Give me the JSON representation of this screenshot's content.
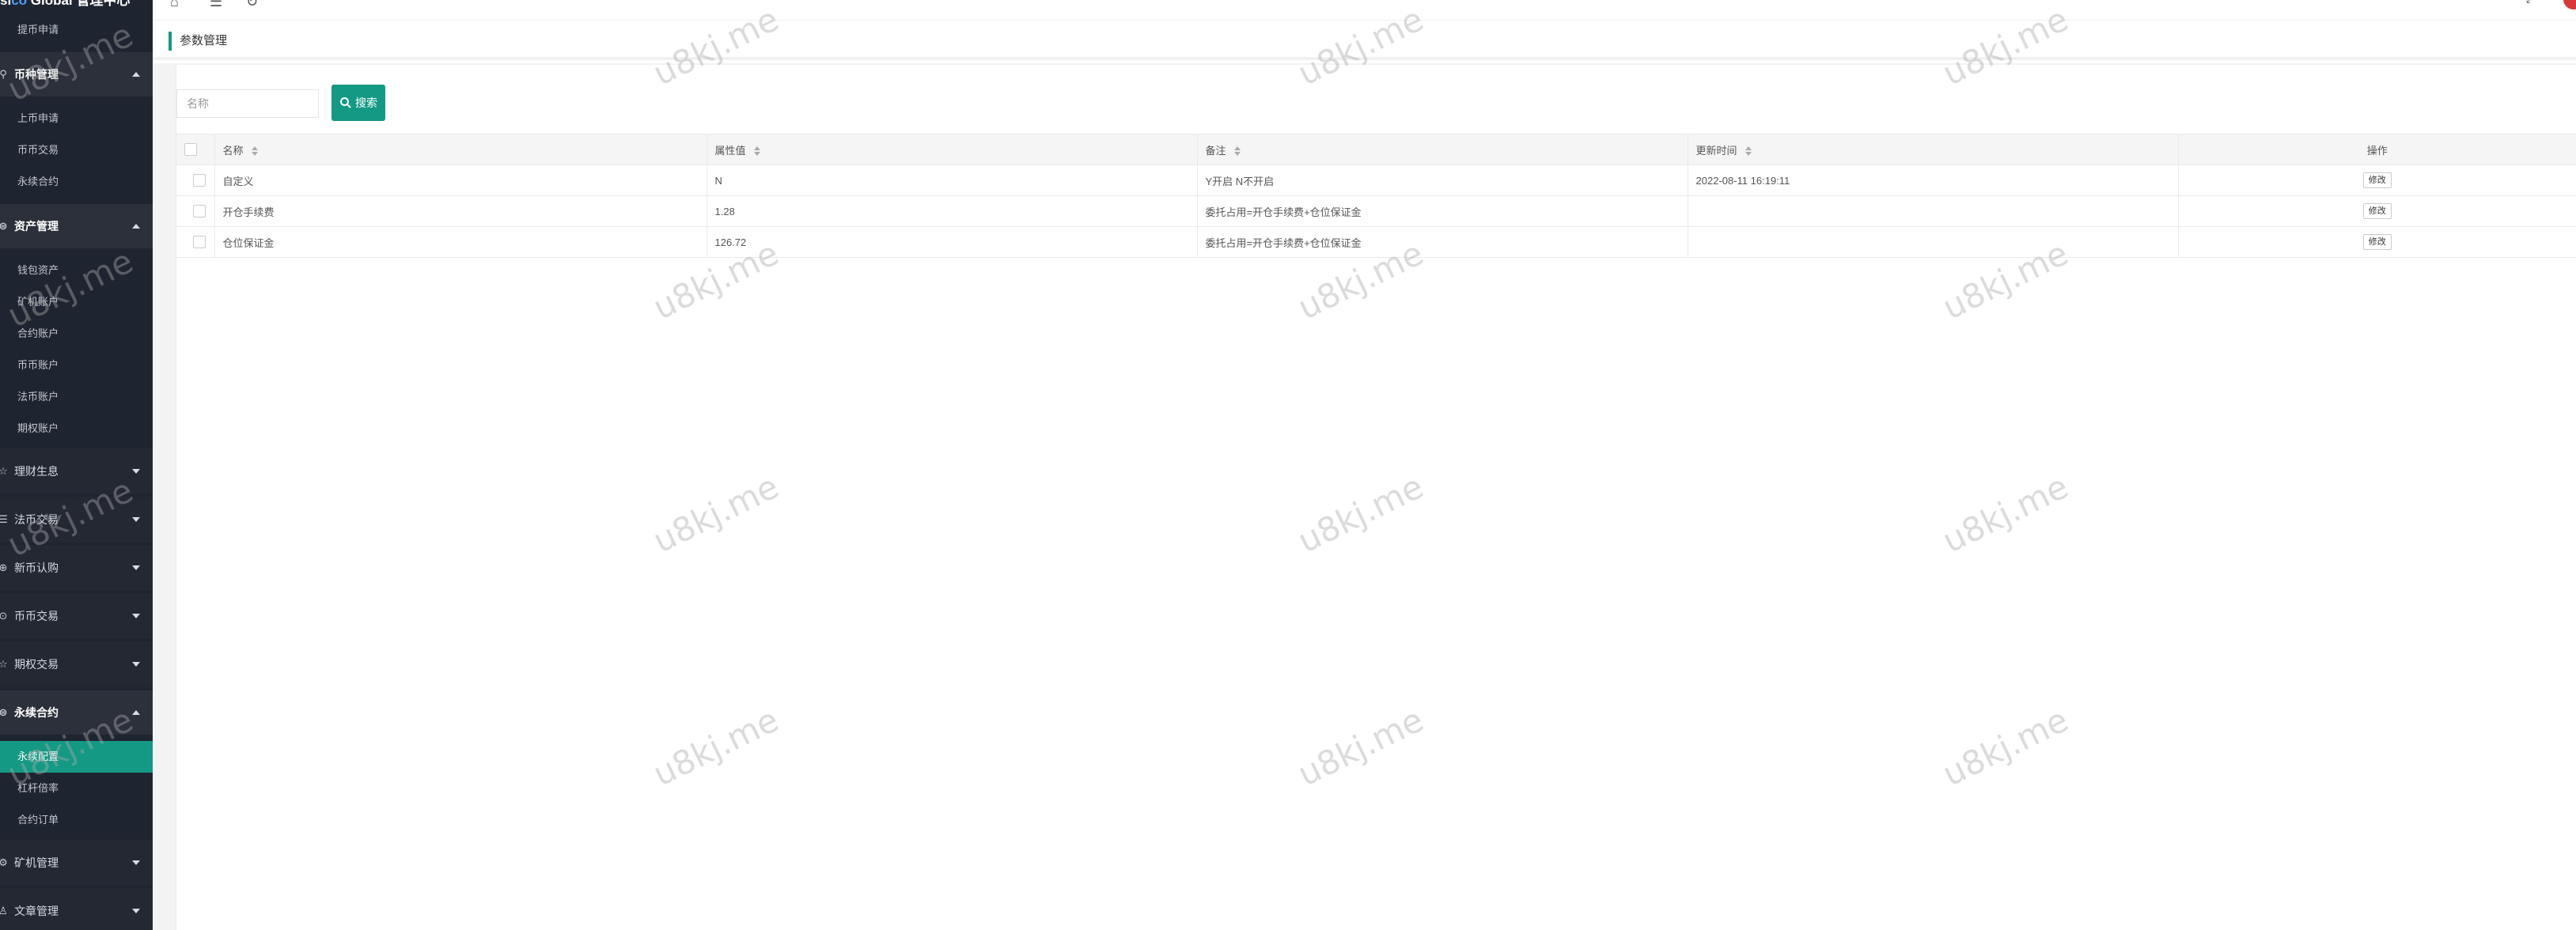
{
  "sidebar": {
    "brand_prefix": "si",
    "brand_accent": "co",
    "brand_suffix": " Global 管理中心",
    "top_item": "提币申请",
    "groups": [
      {
        "label": "币种管理",
        "items": [
          "上币申请",
          "币币交易",
          "永续合约"
        ]
      },
      {
        "label": "资产管理",
        "items": [
          "钱包资产",
          "矿机账户",
          "合约账户",
          "币币账户",
          "法币账户",
          "期权账户"
        ]
      },
      {
        "label": "理财生息"
      },
      {
        "label": "法币交易"
      },
      {
        "label": "新币认购"
      },
      {
        "label": "币币交易"
      },
      {
        "label": "期权交易"
      },
      {
        "label": "永续合约",
        "items": [
          "永续配置",
          "杠杆倍率",
          "合约订单"
        ]
      },
      {
        "label": "矿机管理"
      },
      {
        "label": "文章管理"
      }
    ]
  },
  "breadcrumb": "参数管理",
  "search": {
    "placeholder": "名称",
    "button_label": "搜索"
  },
  "table": {
    "headers": [
      "名称",
      "属性值",
      "备注",
      "更新时间",
      "操作"
    ],
    "rows": [
      {
        "name": "自定义",
        "value": "N",
        "remark": "Y开启 N不开启",
        "updated": "2022-08-11 16:19:11",
        "action": "修改"
      },
      {
        "name": "开仓手续费",
        "value": "1.28",
        "remark": "委托占用=开仓手续费+仓位保证金",
        "updated": "",
        "action": "修改"
      },
      {
        "name": "仓位保证金",
        "value": "126.72",
        "remark": "委托占用=开仓手续费+仓位保证金",
        "updated": "",
        "action": "修改"
      }
    ]
  },
  "watermark": "u8kj.me",
  "colors": {
    "accent": "#149985",
    "sidebar_bg": "#1f2530"
  }
}
